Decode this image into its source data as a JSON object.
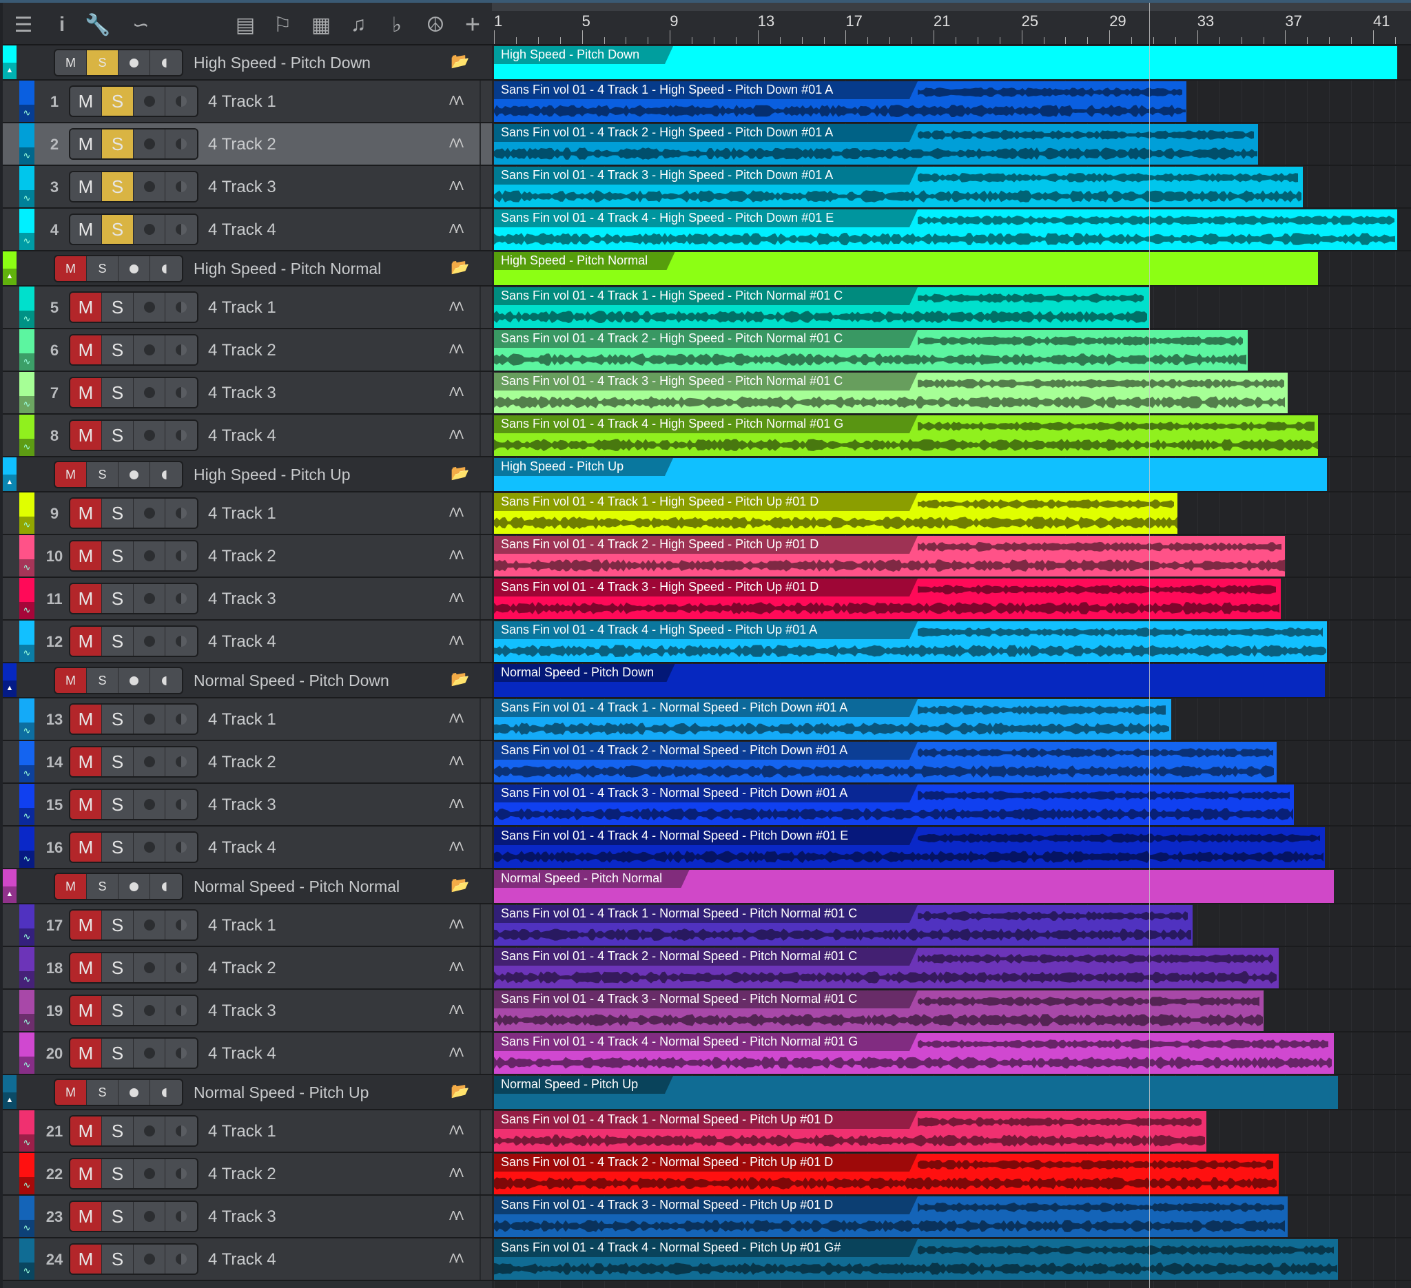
{
  "toolbar": {
    "icons": [
      "menu-icon",
      "info-icon",
      "wrench-icon",
      "automation-icon",
      "mixer-icon",
      "marker-flag-icon",
      "grid-icon",
      "score-icon",
      "chord-icon",
      "tempo-icon",
      "add-track-icon"
    ]
  },
  "ruler": {
    "labels": [
      "1",
      "5",
      "9",
      "13",
      "17",
      "21",
      "25",
      "29",
      "33",
      "37",
      "41"
    ]
  },
  "playhead_bar": 30.8,
  "button_labels": {
    "mute": "M",
    "solo": "S"
  },
  "folders": [
    {
      "name": "High Speed - Pitch Down",
      "color": "#00ffff",
      "end_bar": 42.1,
      "muted": false,
      "soloed": true,
      "tracks": [
        {
          "num": "1",
          "name": "4 Track 1",
          "color": "#0a5fe0",
          "clip": "Sans Fin vol 01 - 4 Track 1 - High Speed - Pitch Down #01 A",
          "end_bar": 32.5,
          "muted": false,
          "soloed": true
        },
        {
          "num": "2",
          "name": "4 Track 2",
          "color": "#009fd8",
          "clip": "Sans Fin vol 01 - 4 Track 2 - High Speed - Pitch Down #01 A",
          "end_bar": 35.75,
          "muted": false,
          "soloed": true,
          "selected": true
        },
        {
          "num": "3",
          "name": "4 Track 3",
          "color": "#00c6ec",
          "clip": "Sans Fin vol 01 - 4 Track 3 - High Speed - Pitch Down #01 A",
          "end_bar": 37.8,
          "muted": false,
          "soloed": true
        },
        {
          "num": "4",
          "name": "4 Track 4",
          "color": "#00f0ff",
          "clip": "Sans Fin vol 01 - 4 Track 4 - High Speed - Pitch Down #01 E",
          "end_bar": 42.1,
          "muted": false,
          "soloed": true
        }
      ]
    },
    {
      "name": "High Speed - Pitch Normal",
      "color": "#8cff14",
      "end_bar": 38.5,
      "muted": true,
      "soloed": false,
      "tracks": [
        {
          "num": "5",
          "name": "4 Track 1",
          "color": "#00e0cc",
          "clip": "Sans Fin vol 01 - 4 Track 1 - High Speed - Pitch Normal  #01 C",
          "end_bar": 30.8,
          "muted": true,
          "soloed": false
        },
        {
          "num": "6",
          "name": "4 Track 2",
          "color": "#5cf5a0",
          "clip": "Sans Fin vol 01 - 4 Track 2 - High Speed - Pitch Normal #01 C",
          "end_bar": 35.3,
          "muted": true,
          "soloed": false
        },
        {
          "num": "7",
          "name": "4 Track 3",
          "color": "#a6ff96",
          "clip": "Sans Fin vol 01 - 4 Track 3 - High Speed - Pitch Normal #01 C",
          "end_bar": 37.1,
          "muted": true,
          "soloed": false
        },
        {
          "num": "8",
          "name": "4 Track 4",
          "color": "#90f01e",
          "clip": "Sans Fin vol 01 - 4 Track 4 - High Speed - Pitch Normal #01 G",
          "end_bar": 38.5,
          "muted": true,
          "soloed": false
        }
      ]
    },
    {
      "name": "High Speed - Pitch Up",
      "color": "#10c0ff",
      "end_bar": 38.9,
      "muted": true,
      "soloed": false,
      "tracks": [
        {
          "num": "9",
          "name": "4 Track 1",
          "color": "#e0ff00",
          "clip": "Sans Fin vol 01 - 4 Track 1 - High Speed - Pitch Up  #01 D",
          "end_bar": 32.1,
          "muted": true,
          "soloed": false
        },
        {
          "num": "10",
          "name": "4 Track 2",
          "color": "#ff5288",
          "clip": "Sans Fin vol 01 - 4 Track 2 - High Speed - Pitch Up #01 D",
          "end_bar": 37.0,
          "muted": true,
          "soloed": false
        },
        {
          "num": "11",
          "name": "4 Track 3",
          "color": "#ff0a58",
          "clip": "Sans Fin vol 01 - 4 Track 3 - High Speed - Pitch Up #01 D",
          "end_bar": 36.8,
          "muted": true,
          "soloed": false
        },
        {
          "num": "12",
          "name": "4 Track 4",
          "color": "#12c0ff",
          "clip": "Sans Fin vol 01 - 4 Track 4 - High Speed - Pitch Up #01 A",
          "end_bar": 38.9,
          "muted": true,
          "soloed": false
        }
      ]
    },
    {
      "name": "Normal Speed - Pitch Down",
      "color": "#0628c0",
      "end_bar": 38.8,
      "muted": true,
      "soloed": false,
      "tracks": [
        {
          "num": "13",
          "name": "4 Track 1",
          "color": "#14aaf8",
          "clip": "Sans Fin vol 01 - 4 Track 1 - Normal Speed - Pitch Down  #01 A",
          "end_bar": 31.8,
          "muted": true,
          "soloed": false
        },
        {
          "num": "14",
          "name": "4 Track 2",
          "color": "#1464f0",
          "clip": "Sans Fin vol 01 - 4 Track 2 - Normal Speed - Pitch Down #01 A",
          "end_bar": 36.6,
          "muted": true,
          "soloed": false
        },
        {
          "num": "15",
          "name": "4 Track 3",
          "color": "#1040f0",
          "clip": "Sans Fin vol 01 - 4 Track 3 - Normal Speed - Pitch Down #01 A",
          "end_bar": 37.4,
          "muted": true,
          "soloed": false
        },
        {
          "num": "16",
          "name": "4 Track 4",
          "color": "#0a28c8",
          "clip": "Sans Fin vol 01 - 4 Track 4 - Normal Speed - Pitch Down #01 E",
          "end_bar": 38.8,
          "muted": true,
          "soloed": false
        }
      ]
    },
    {
      "name": "Normal Speed - Pitch Normal",
      "color": "#d048c8",
      "end_bar": 39.2,
      "muted": true,
      "soloed": false,
      "tracks": [
        {
          "num": "17",
          "name": "4 Track 1",
          "color": "#5032c0",
          "clip": "Sans Fin vol 01 - 4 Track 1 - Normal Speed - Pitch Normal  #01 C",
          "end_bar": 32.8,
          "muted": true,
          "soloed": false
        },
        {
          "num": "18",
          "name": "4 Track 2",
          "color": "#6c34b8",
          "clip": "Sans Fin vol 01 - 4 Track 2 - Normal Speed - Pitch Normal #01 C",
          "end_bar": 36.7,
          "muted": true,
          "soloed": false
        },
        {
          "num": "19",
          "name": "4 Track 3",
          "color": "#a848a8",
          "clip": "Sans Fin vol 01 - 4 Track 3 - Normal Speed - Pitch Normal #01 C",
          "end_bar": 36.0,
          "muted": true,
          "soloed": false
        },
        {
          "num": "20",
          "name": "4 Track 4",
          "color": "#d048d0",
          "clip": "Sans Fin vol 01 - 4 Track 4 - Normal Speed - Pitch Normal #01 G",
          "end_bar": 39.2,
          "muted": true,
          "soloed": false
        }
      ]
    },
    {
      "name": "Normal Speed - Pitch Up",
      "color": "#106c94",
      "end_bar": 39.4,
      "muted": true,
      "soloed": false,
      "tracks": [
        {
          "num": "21",
          "name": "4 Track 1",
          "color": "#f03070",
          "clip": "Sans Fin vol 01 - 4 Track 1 - Normal Speed - Pitch Up #01 D",
          "end_bar": 33.4,
          "muted": true,
          "soloed": false
        },
        {
          "num": "22",
          "name": "4 Track 2",
          "color": "#ff1010",
          "clip": "Sans Fin vol 01 - 4 Track 2 - Normal Speed - Pitch Up #01 D",
          "end_bar": 36.7,
          "muted": true,
          "soloed": false
        },
        {
          "num": "23",
          "name": "4 Track 3",
          "color": "#1464b8",
          "clip": "Sans Fin vol 01 - 4 Track 3 - Normal Speed - Pitch Up #01 D",
          "end_bar": 37.1,
          "muted": true,
          "soloed": false
        },
        {
          "num": "24",
          "name": "4 Track 4",
          "color": "#106c94",
          "clip": "Sans Fin vol 01 - 4 Track 4 - Normal Speed - Pitch Up #01 G#",
          "end_bar": 39.4,
          "muted": true,
          "soloed": false
        }
      ]
    }
  ]
}
